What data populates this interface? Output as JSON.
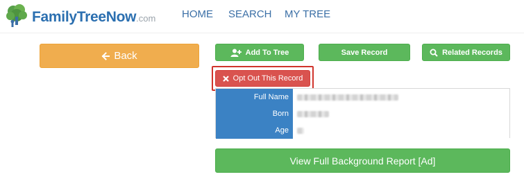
{
  "header": {
    "logo": {
      "brand": "FamilyTreeNow",
      "tld": ".com"
    },
    "nav": [
      {
        "label": "HOME"
      },
      {
        "label": "SEARCH"
      },
      {
        "label": "MY TREE"
      }
    ]
  },
  "actions": {
    "back_label": "Back",
    "add_to_tree_label": "Add To Tree",
    "save_record_label": "Save Record",
    "related_records_label": "Related Records",
    "opt_out_label": "Opt Out This Record",
    "report_label": "View Full Background Report [Ad]"
  },
  "record": {
    "rows": [
      {
        "label": "Full Name"
      },
      {
        "label": "Born"
      },
      {
        "label": "Age"
      }
    ]
  },
  "colors": {
    "brand_blue": "#2b6fb0",
    "back_orange": "#f0ad4e",
    "action_green": "#5cb85c",
    "optout_red": "#d9534f",
    "highlight_border": "#d0342c",
    "label_blue": "#3b82c4"
  },
  "icons": {
    "logo": "tree-icon",
    "back": "arrow-left-icon",
    "add_to_tree": "user-plus-icon",
    "related_records": "search-icon",
    "opt_out": "close-icon"
  }
}
